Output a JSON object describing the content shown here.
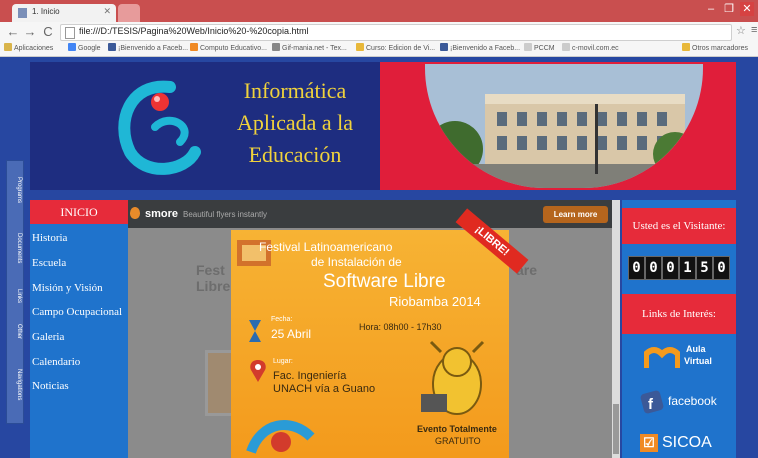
{
  "browser": {
    "tab_title": "1. Inicio",
    "url": "file:///D:/TESIS/Pagina%20Web/Inicio%20-%20copia.html",
    "bookmarks": [
      "Aplicaciones",
      "Google",
      "¡Bienvenido a Faceb...",
      "Computo Educativo...",
      "Gif-mania.net - Tex...",
      "Curso: Edicion de Vi...",
      "¡Bienvenido a Faceb...",
      "PCCM",
      "c-movil.com.ec",
      "Otros marcadores"
    ]
  },
  "side_tabs": [
    "Programs",
    "Documents",
    "Links",
    "Other",
    "Navigations"
  ],
  "banner": {
    "title_lines": [
      "Informática",
      "Aplicada a la",
      "Educación"
    ]
  },
  "nav": {
    "active": "INICIO",
    "items": [
      "Historia",
      "Escuela",
      "Misión y Visión",
      "Campo Ocupacional",
      "Galeria",
      "Calendario",
      "Noticias"
    ]
  },
  "smore": {
    "logo": "smore",
    "tagline": "Beautiful flyers instantly",
    "learn_more": "Learn more",
    "ghost_left": [
      "Fest",
      "Libre"
    ],
    "ghost_right": "are"
  },
  "flyer": {
    "line1": "Festival Latinoamericano",
    "line2": "de Instalación de",
    "line3": "Software Libre",
    "line4": "Riobamba 2014",
    "badge": "¡LIBRE!",
    "fecha_label": "Fecha:",
    "fecha_value": "25 Abril",
    "hora": "Hora: 08h00 - 17h30",
    "lugar_label": "Lugar:",
    "lugar_line1": "Fac. Ingeniería",
    "lugar_line2": "UNACH vía a Guano",
    "evento_line1": "Evento Totalmente",
    "evento_line2": "GRATUITO"
  },
  "right": {
    "visitor_heading": "Usted es el Visitante:",
    "counter": [
      "0",
      "0",
      "0",
      "1",
      "5",
      "0"
    ],
    "links_heading": "Links de Interés:",
    "aula_line1": "Aula",
    "aula_line2": "Virtual",
    "facebook": "facebook",
    "sicoa": "SICOA"
  },
  "colors": {
    "page_bg": "#2747a1",
    "red": "#e62b3a",
    "nav_blue": "#1f73cc",
    "flyer_orange": "#f7b334"
  }
}
